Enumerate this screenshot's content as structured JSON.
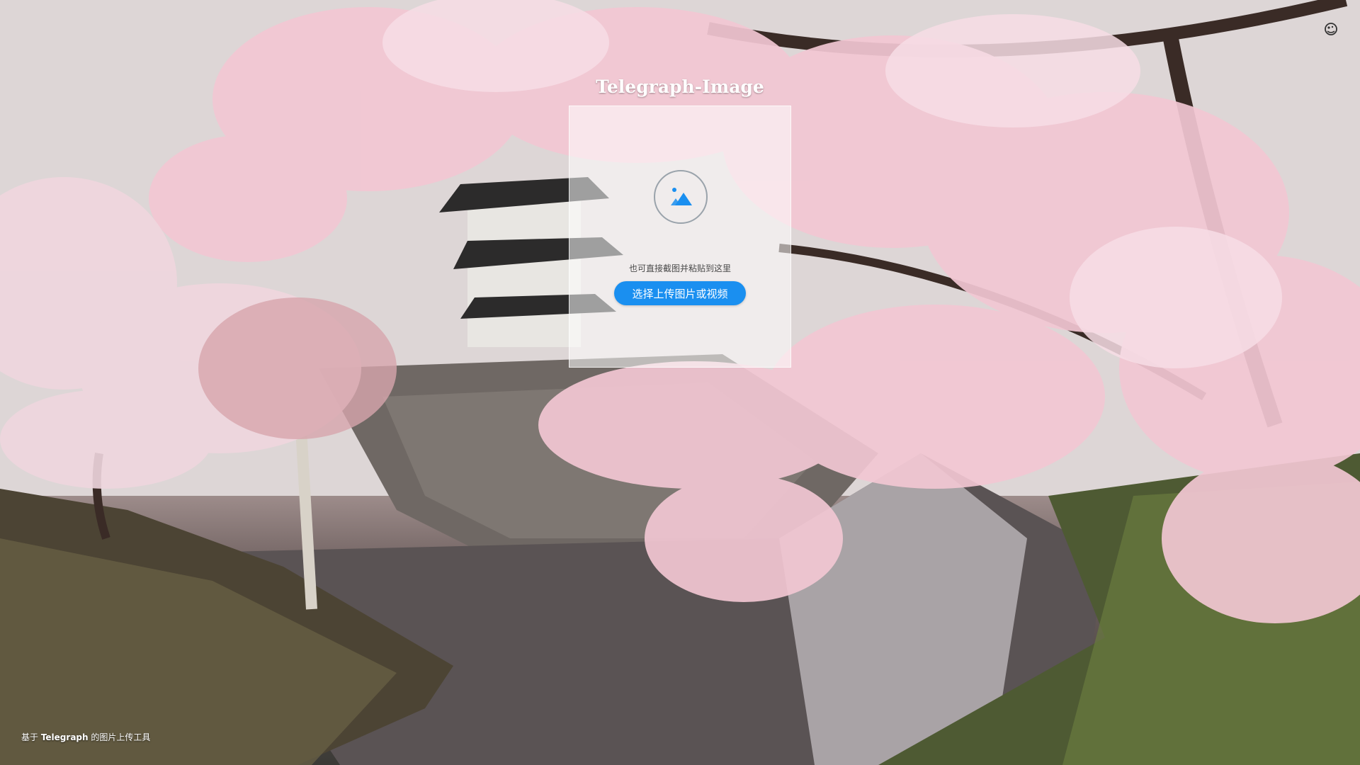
{
  "app": {
    "title": "Telegraph-Image"
  },
  "upload": {
    "hint": "也可直接截图并粘贴到这里",
    "button_label": "选择上传图片或视频"
  },
  "footer": {
    "prefix": "基于 ",
    "brand": "Telegraph",
    "suffix": " 的图片上传工具"
  },
  "icons": {
    "theme": "theme-toggle-icon",
    "upload": "image-upload-icon"
  },
  "colors": {
    "accent": "#1a8ff0",
    "blossom": "#f2c7d3"
  }
}
